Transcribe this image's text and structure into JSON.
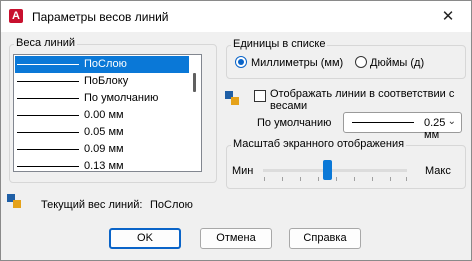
{
  "window": {
    "title": "Параметры весов линий",
    "close": "✕"
  },
  "lineweights": {
    "legend": "Веса линий",
    "items": [
      {
        "label": "ПоСлою",
        "selected": true
      },
      {
        "label": "ПоБлоку",
        "selected": false
      },
      {
        "label": "По умолчанию",
        "selected": false
      },
      {
        "label": "0.00 мм",
        "selected": false
      },
      {
        "label": "0.05 мм",
        "selected": false
      },
      {
        "label": "0.09 мм",
        "selected": false
      },
      {
        "label": "0.13 мм",
        "selected": false
      }
    ]
  },
  "units": {
    "legend": "Единицы в списке",
    "mm": {
      "label": "Миллиметры (мм)",
      "checked": true
    },
    "inch": {
      "label": "Дюймы (д)",
      "checked": false
    }
  },
  "display": {
    "checkbox_label_line1": "Отображать линии в соответствии с",
    "checkbox_label_line2": "весами",
    "checked": false
  },
  "default": {
    "label": "По умолчанию",
    "value": "0.25 мм"
  },
  "scale": {
    "legend": "Масштаб экранного отображения",
    "min": "Мин",
    "max": "Макс",
    "level": 0.43
  },
  "current": {
    "label": "Текущий вес линий:",
    "value": "ПоСлою"
  },
  "buttons": {
    "ok": "OK",
    "cancel": "Отмена",
    "help": "Справка"
  },
  "colors": {
    "accent": "#0a78d7",
    "app_icon": "#c8102e"
  },
  "icons": {
    "app": "autocad-icon",
    "display": "lineweight-display-icon",
    "current": "lineweight-current-icon"
  }
}
